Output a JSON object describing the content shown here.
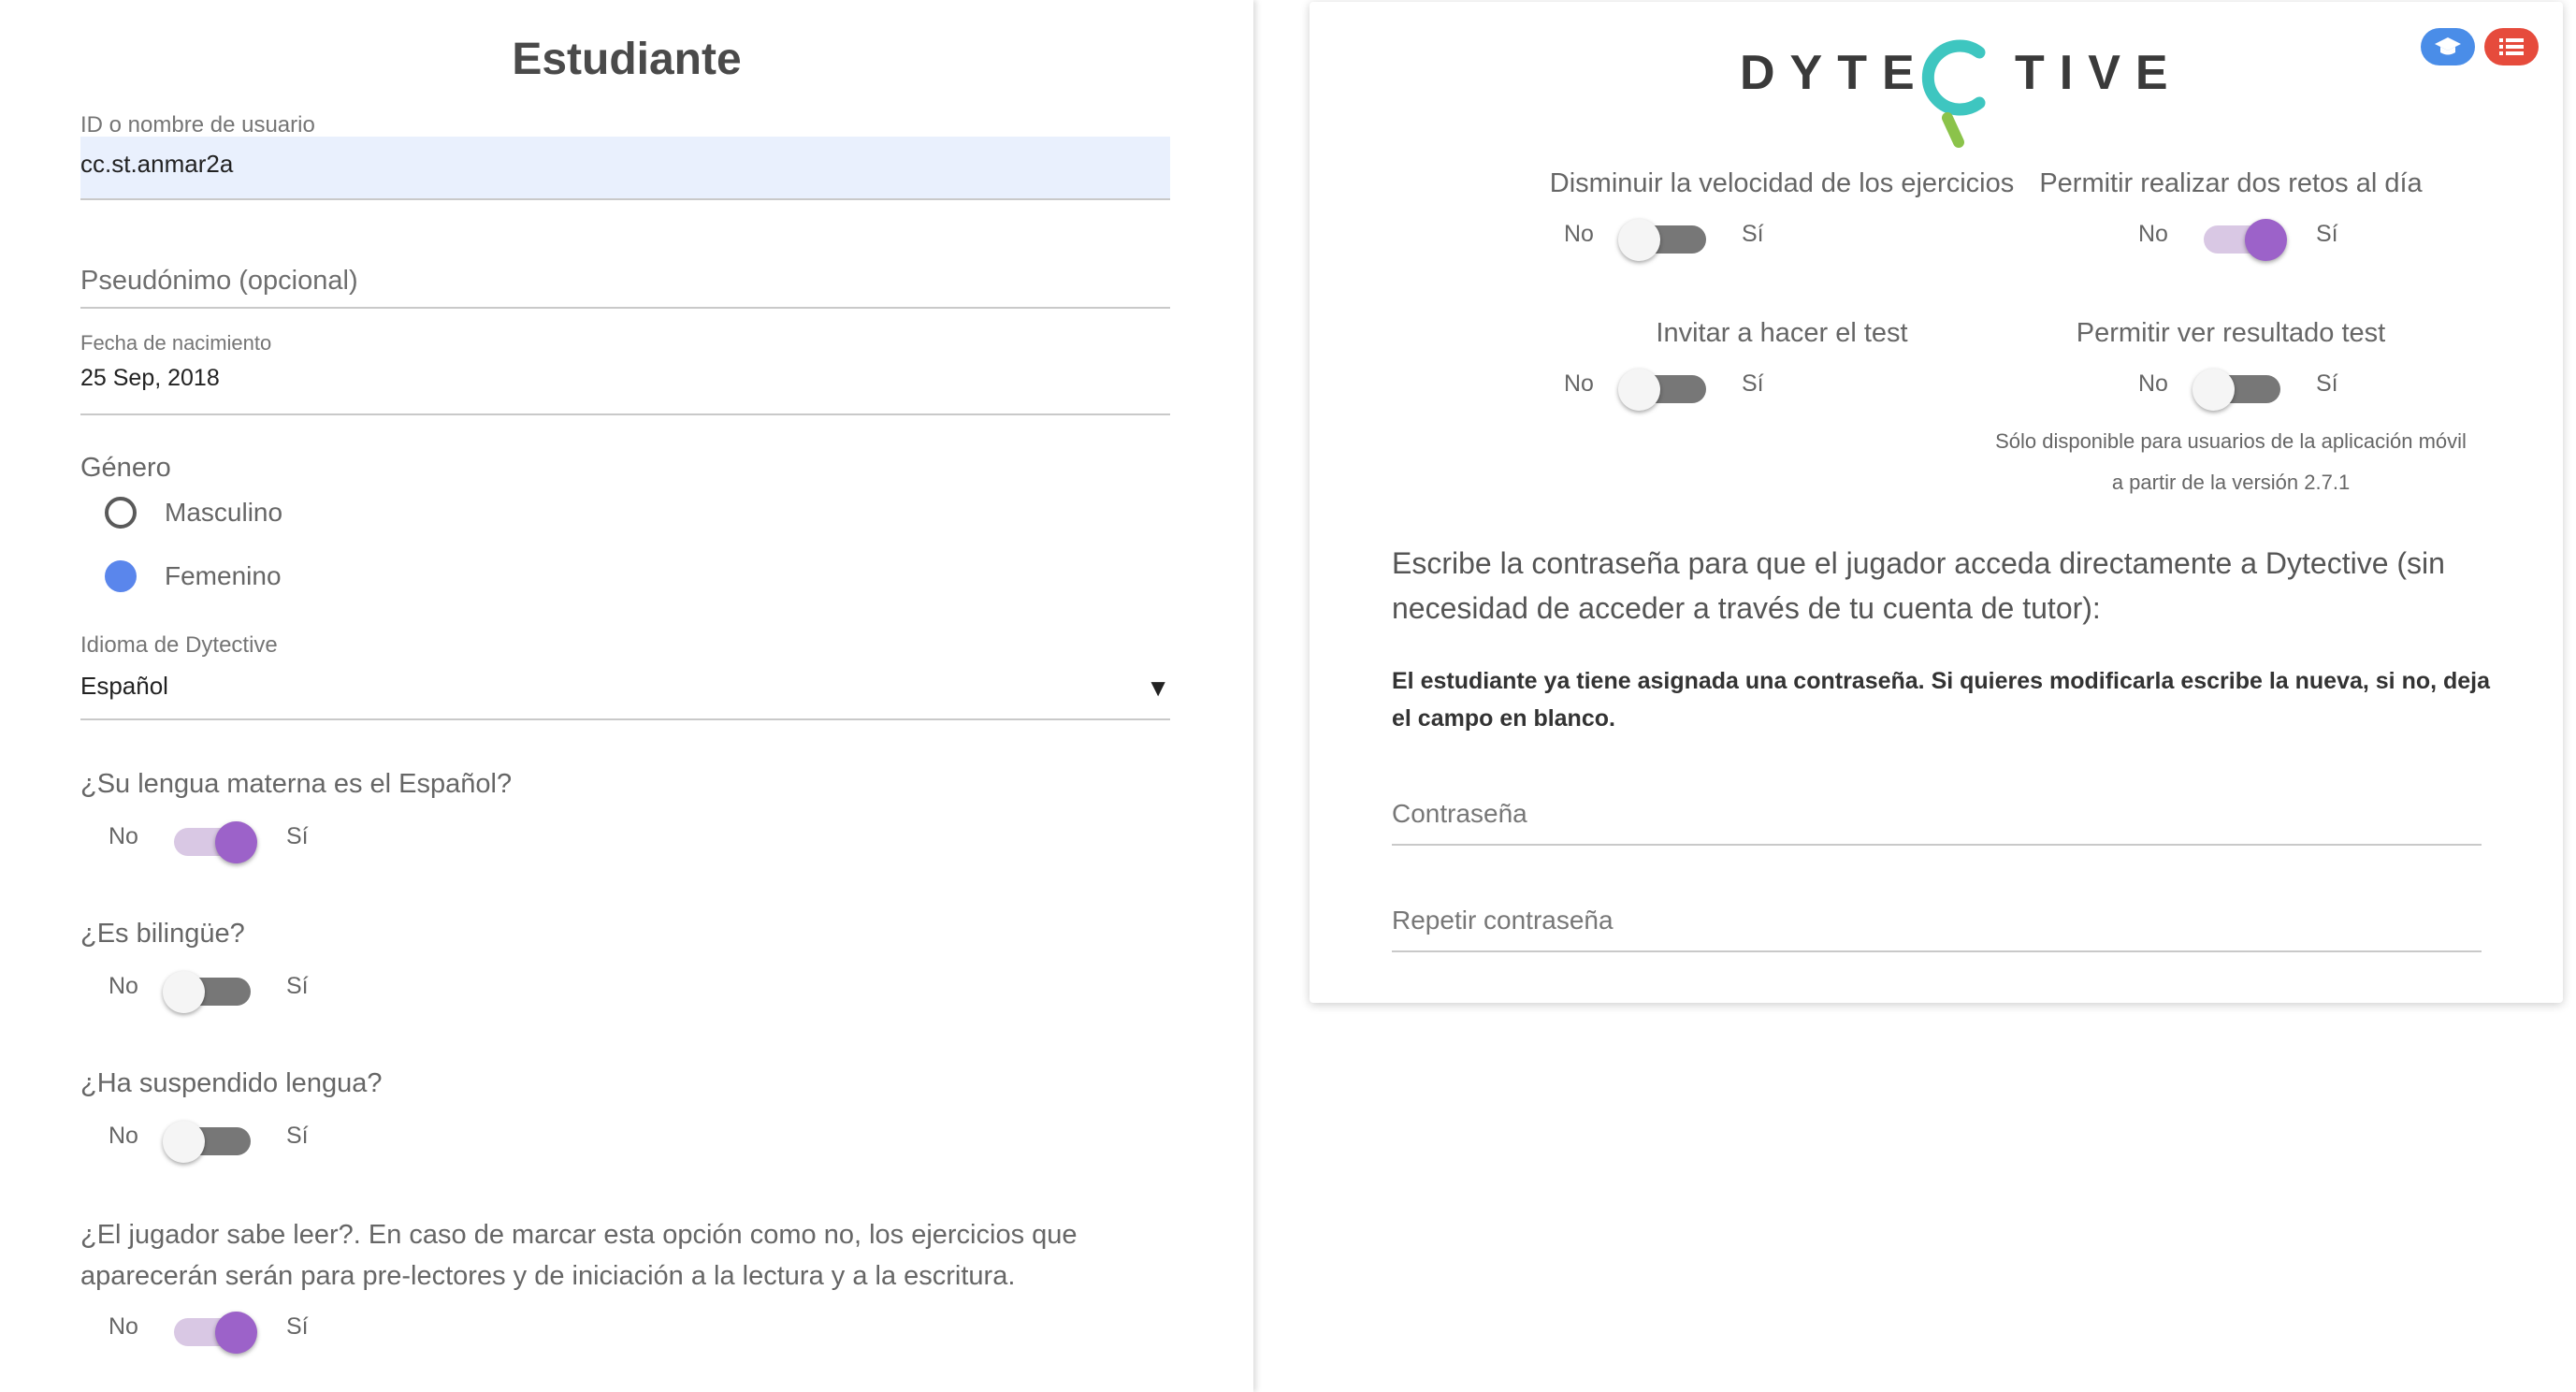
{
  "student_form": {
    "title": "Estudiante",
    "username": {
      "label": "ID o nombre de usuario",
      "value": "cc.st.anmar2a"
    },
    "pseudonym": {
      "placeholder": "Pseudónimo (opcional)"
    },
    "birthdate": {
      "label": "Fecha de nacimiento",
      "value": "25 Sep, 2018"
    },
    "gender": {
      "label": "Género",
      "options": [
        {
          "label": "Masculino",
          "selected": false
        },
        {
          "label": "Femenino",
          "selected": true
        }
      ]
    },
    "language": {
      "label": "Idioma de Dytective",
      "value": "Español",
      "arrow": "▼"
    },
    "questions": [
      {
        "label": "¿Su lengua materna es el Español?",
        "no": "No",
        "yes": "Sí",
        "on": true
      },
      {
        "label": "¿Es bilingüe?",
        "no": "No",
        "yes": "Sí",
        "on": false
      },
      {
        "label": "¿Ha suspendido lengua?",
        "no": "No",
        "yes": "Sí",
        "on": false
      },
      {
        "label": "¿El jugador sabe leer?. En caso de marcar esta opción como no, los ejercicios que aparecerán serán para pre-lectores y de iniciación a la lectura y a la escritura.",
        "no": "No",
        "yes": "Sí",
        "on": true
      }
    ]
  },
  "settings_card": {
    "logo_text": {
      "left": "DYTE",
      "right": "TIVE"
    },
    "buttons": [
      {
        "icon": "graduation-cap-icon",
        "color": "#4a8de8"
      },
      {
        "icon": "list-icon",
        "color": "#e64b3c"
      }
    ],
    "options": [
      {
        "label": "Disminuir la velocidad de los ejercicios",
        "no": "No",
        "yes": "Sí",
        "on": false
      },
      {
        "label": "Permitir realizar dos retos al día",
        "no": "No",
        "yes": "Sí",
        "on": true
      },
      {
        "label": "Invitar a hacer el test",
        "no": "No",
        "yes": "Sí",
        "on": false
      },
      {
        "label": "Permitir ver resultado test",
        "no": "No",
        "yes": "Sí",
        "on": false
      }
    ],
    "test_note_line1": "Sólo disponible para usuarios de la aplicación móvil",
    "test_note_line2": "a partir de la versión 2.7.1",
    "password_intro": "Escribe la contraseña para que el jugador acceda directamente a Dytective (sin necesidad de acceder a través de tu cuenta de tutor):",
    "password_note": "El estudiante ya tiene asignada una contraseña. Si quieres modificarla escribe la nueva, si no, deja el campo en blanco.",
    "password_placeholder": "Contraseña",
    "repeat_password_placeholder": "Repetir contraseña"
  },
  "colors": {
    "accent_purple": "#9c62c9",
    "radio_blue": "#5a86ec",
    "logo_teal": "#3ec6c0",
    "logo_green": "#8bc34a"
  }
}
